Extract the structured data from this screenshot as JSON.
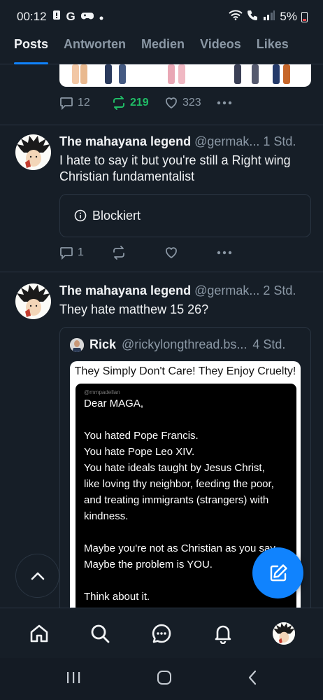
{
  "status_bar": {
    "time": "00:12",
    "left_icons": [
      "notification-icon",
      "google-icon",
      "gamepad-icon",
      "dot-icon"
    ],
    "right_icons": [
      "wifi-icon",
      "call-icon",
      "signal-icon"
    ],
    "battery": "5%"
  },
  "tabs": [
    {
      "label": "Posts",
      "active": true
    },
    {
      "label": "Antworten",
      "active": false
    },
    {
      "label": "Medien",
      "active": false
    },
    {
      "label": "Videos",
      "active": false
    },
    {
      "label": "Likes",
      "active": false
    }
  ],
  "posts": [
    {
      "actions": {
        "replies": "12",
        "reposts": "219",
        "likes": "323"
      }
    },
    {
      "author": "The mahayana legend",
      "handle": "@germak...",
      "time": "1 Std.",
      "text": "I hate to say it but you're still a Right wing Christian fundamentalist",
      "blocked_label": "Blockiert",
      "actions": {
        "replies": "1",
        "reposts": "",
        "likes": ""
      }
    },
    {
      "author": "The mahayana legend",
      "handle": "@germak...",
      "time": "2 Std.",
      "text": "They hate  matthew 15 26?",
      "quote": {
        "author": "Rick",
        "handle": "@rickylongthread.bs...",
        "time": "4 Std.",
        "image": {
          "title": "They Simply Don't Care! They Enjoy Cruelty!",
          "handle": "@mmpadellan",
          "lines": [
            "Dear MAGA,",
            "",
            "You hated Pope Francis.",
            "You hate Pope Leo XIV.",
            "You hate ideals taught by Jesus Christ,",
            "like loving thy neighbor, feeding the poor,",
            "and treating immigrants (strangers) with",
            "kindness.",
            "",
            "Maybe you're not as Christian as you say.",
            "Maybe the problem is YOU.",
            "",
            "Think about it."
          ]
        }
      }
    }
  ],
  "colors": {
    "background": "#161e27",
    "accent": "#1083fe",
    "repost_active": "#20bc66",
    "muted_text": "#8b98a5",
    "border": "#2a3542"
  }
}
